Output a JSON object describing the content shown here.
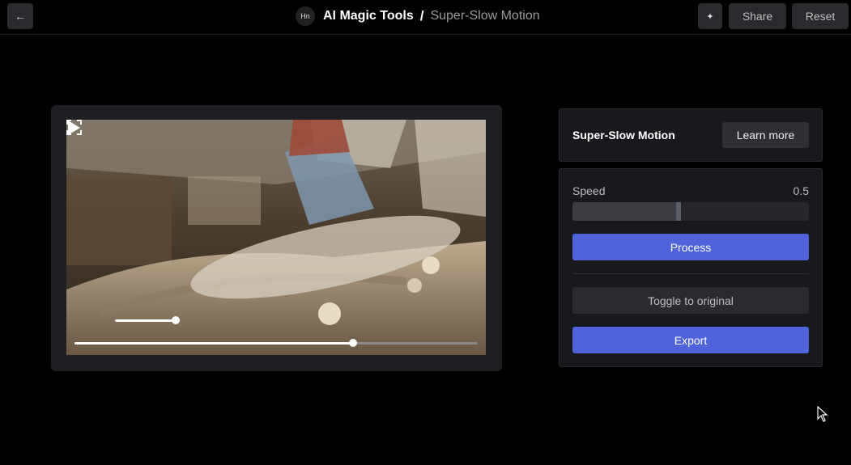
{
  "header": {
    "back_icon": "arrow-left-icon",
    "avatar_text": "Hn",
    "app_name": "AI Magic Tools",
    "separator": "/",
    "page_name": "Super-Slow Motion",
    "sparkle_icon": "sparkle-icon",
    "share_label": "Share",
    "reset_label": "Reset"
  },
  "player": {
    "play_icon": "play-icon",
    "fullscreen_icon": "fullscreen-icon",
    "volume": 1.0,
    "progress": 0.69
  },
  "tool_panel": {
    "title": "Super-Slow Motion",
    "learn_more_label": "Learn more"
  },
  "settings": {
    "speed_label": "Speed",
    "speed_value": "0.5",
    "speed_fraction": 0.45,
    "process_label": "Process",
    "toggle_label": "Toggle to original",
    "export_label": "Export"
  },
  "colors": {
    "accent": "#4f63db",
    "button_bg": "#2a2b2e",
    "panel_bg": "#18191c"
  }
}
